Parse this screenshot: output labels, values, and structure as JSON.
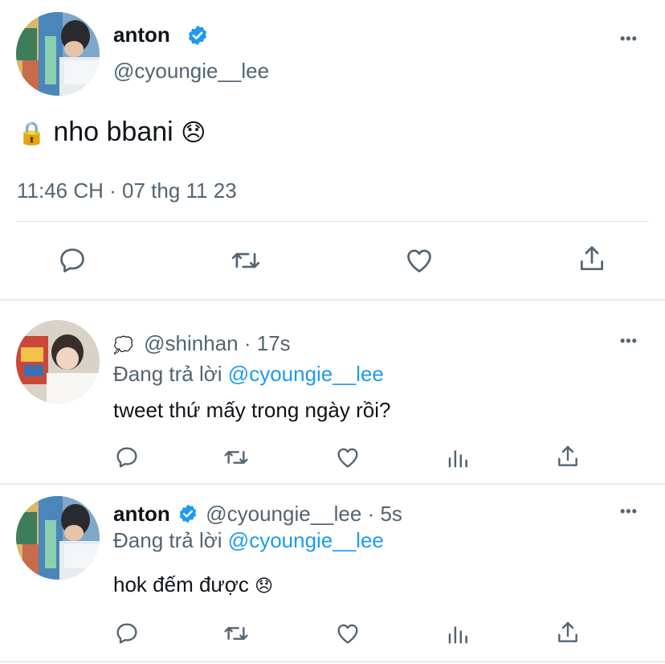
{
  "main_tweet": {
    "display_name": "anton",
    "handle": "@cyoungie__lee",
    "text": "nho bbani",
    "lock_emoji": "🔒",
    "emoji": "😞",
    "timestamp": "11:46 CH · 07 thg 11 23",
    "more": "•••"
  },
  "replies": [
    {
      "name_emoji": "💭",
      "handle": "@shinhan",
      "time": "· 17s",
      "replying_prefix": "Đang trả lời",
      "replying_to": "@cyoungie__lee",
      "text": "tweet thứ mấy trong ngày rồi?",
      "more": "•••"
    },
    {
      "display_name": "anton",
      "handle": "@cyoungie__lee",
      "time": "· 5s",
      "replying_prefix": "Đang trả lời",
      "replying_to": "@cyoungie__lee",
      "text": "hok đếm được",
      "emoji": "😞",
      "more": "•••"
    }
  ],
  "colors": {
    "accent": "#1d9bf0",
    "secondary_text": "#536471",
    "icon": "#536471",
    "divider": "#dfe3e7"
  }
}
